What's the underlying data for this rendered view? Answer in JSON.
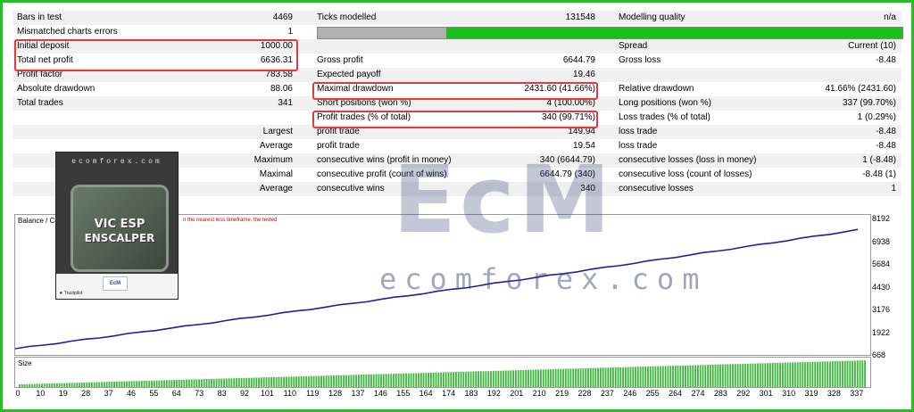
{
  "stats": [
    {
      "cols": [
        {
          "label": "Bars in test",
          "value": "4469"
        },
        {
          "label": "Ticks modelled",
          "value": "131548"
        },
        {
          "label": "Modelling quality",
          "value": "n/a"
        }
      ]
    },
    {
      "cols": [
        {
          "label": "Mismatched charts errors",
          "value": "1"
        },
        {
          "label": "",
          "value": ""
        },
        {
          "label": "",
          "value": ""
        }
      ]
    },
    {
      "cols": [
        {
          "label": "Initial deposit",
          "value": "1000.00"
        },
        {
          "label": "",
          "value": ""
        },
        {
          "label": "Spread",
          "value": "Current (10)"
        }
      ]
    },
    {
      "cols": [
        {
          "label": "Total net profit",
          "value": "6636.31"
        },
        {
          "label": "Gross profit",
          "value": "6644.79"
        },
        {
          "label": "Gross loss",
          "value": "-8.48"
        }
      ]
    },
    {
      "cols": [
        {
          "label": "Profit factor",
          "value": "783.58"
        },
        {
          "label": "Expected payoff",
          "value": "19.46"
        },
        {
          "label": "",
          "value": ""
        }
      ]
    },
    {
      "cols": [
        {
          "label": "Absolute drawdown",
          "value": "88.06"
        },
        {
          "label": "Maximal drawdown",
          "value": "2431.60 (41.66%)"
        },
        {
          "label": "Relative drawdown",
          "value": "41.66% (2431.60)"
        }
      ]
    },
    {
      "cols": [
        {
          "label": "Total trades",
          "value": "341"
        },
        {
          "label": "Short positions (won %)",
          "value": "4 (100.00%)"
        },
        {
          "label": "Long positions (won %)",
          "value": "337 (99.70%)"
        }
      ]
    },
    {
      "cols": [
        {
          "label": "",
          "value": ""
        },
        {
          "label": "Profit trades (% of total)",
          "value": "340 (99.71%)"
        },
        {
          "label": "Loss trades (% of total)",
          "value": "1 (0.29%)"
        }
      ]
    },
    {
      "cols": [
        {
          "label": "",
          "value": "Largest"
        },
        {
          "label": "profit trade",
          "value": "149.94"
        },
        {
          "label": "loss trade",
          "value": "-8.48"
        }
      ]
    },
    {
      "cols": [
        {
          "label": "",
          "value": "Average"
        },
        {
          "label": "profit trade",
          "value": "19.54"
        },
        {
          "label": "loss trade",
          "value": "-8.48"
        }
      ]
    },
    {
      "cols": [
        {
          "label": "",
          "value": "Maximum"
        },
        {
          "label": "consecutive wins (profit in money)",
          "value": "340 (6644.79)"
        },
        {
          "label": "consecutive losses (loss in money)",
          "value": "1 (-8.48)"
        }
      ]
    },
    {
      "cols": [
        {
          "label": "",
          "value": "Maximal"
        },
        {
          "label": "consecutive profit (count of wins)",
          "value": "6644.79 (340)"
        },
        {
          "label": "consecutive loss (count of losses)",
          "value": "-8.48 (1)"
        }
      ]
    },
    {
      "cols": [
        {
          "label": "",
          "value": "Average"
        },
        {
          "label": "consecutive wins",
          "value": "340"
        },
        {
          "label": "consecutive losses",
          "value": "1"
        }
      ]
    }
  ],
  "modelling_quality_bar": {
    "gray_fraction": 0.22
  },
  "balance_chart": {
    "title": "Balance / Co",
    "note_left": "n the nearest less timeframe, the tested",
    "y_ticks": [
      "8192",
      "6938",
      "5684",
      "4430",
      "3176",
      "1922",
      "668"
    ],
    "x_ticks": [
      "0",
      "10",
      "19",
      "28",
      "37",
      "46",
      "55",
      "64",
      "73",
      "83",
      "92",
      "101",
      "110",
      "119",
      "128",
      "137",
      "146",
      "155",
      "164",
      "174",
      "183",
      "192",
      "201",
      "210",
      "219",
      "228",
      "237",
      "246",
      "255",
      "264",
      "274",
      "283",
      "292",
      "301",
      "310",
      "319",
      "328",
      "337"
    ],
    "line_color": "#1f1fa0"
  },
  "chart_data": {
    "type": "line",
    "x": [
      0,
      340
    ],
    "series": [
      {
        "values": [
          668,
          7634
        ]
      }
    ],
    "ylim": [
      668,
      8192
    ],
    "xlim": [
      0,
      345
    ]
  },
  "size_chart": {
    "title": "Size",
    "bar_color": "#3cb83c"
  },
  "watermark": {
    "logo": "EcM",
    "url": "ecomforex.com"
  },
  "product": {
    "brand": "ecomforex.com",
    "title_line1": "VIC ESP",
    "title_line2": "ENSCALPER",
    "badge": "EcM",
    "rating": "★ Trustpilot"
  },
  "colors": {
    "highlight": "#e23a3a",
    "frame": "#1fc21f",
    "quality_bar": "#19c019"
  }
}
